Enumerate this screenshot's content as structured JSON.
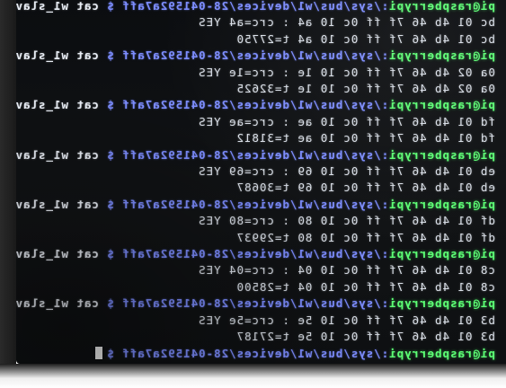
{
  "terminal": {
    "prompt_user": "pi@raspberrypi",
    "prompt_path": ":/sys/bus/w1/devices/28-041592a7aff $",
    "command": "cat w1_slave",
    "lines": [
      {
        "kind": "cmd",
        "user": "pi@raspberrypi",
        "path": ":/sys/bus/w1/devices/28-041592a7aff $",
        "cmd": "cat w1_slave"
      },
      {
        "kind": "out",
        "text": "bc 01 4b 46 7f ff 0c 10 a4 : crc=a4 YES"
      },
      {
        "kind": "out",
        "text": "bc 01 4b 46 7f ff 0c 10 a4 t=27750"
      },
      {
        "kind": "cmd",
        "user": "pi@raspberrypi",
        "path": ":/sys/bus/w1/devices/28-041592a7aff $",
        "cmd": "cat w1_slave"
      },
      {
        "kind": "out",
        "text": "0a 02 4b 46 7f ff 0c 10 1e : crc=1e YES"
      },
      {
        "kind": "out",
        "text": "0a 02 4b 46 7f ff 0c 10 1e t=32625"
      },
      {
        "kind": "cmd",
        "user": "pi@raspberrypi",
        "path": ":/sys/bus/w1/devices/28-041592a7aff $",
        "cmd": "cat w1_slave"
      },
      {
        "kind": "out",
        "text": "fd 01 4b 46 7f ff 0c 10 ae : crc=ae YES"
      },
      {
        "kind": "out",
        "text": "fd 01 4b 46 7f ff 0c 10 ae t=31812"
      },
      {
        "kind": "cmd",
        "user": "pi@raspberrypi",
        "path": ":/sys/bus/w1/devices/28-041592a7aff $",
        "cmd": "cat w1_slave"
      },
      {
        "kind": "out",
        "text": "eb 01 4b 46 7f ff 0c 10 69 : crc=69 YES"
      },
      {
        "kind": "out",
        "text": "eb 01 4b 46 7f ff 0c 10 69 t=30687"
      },
      {
        "kind": "cmd",
        "user": "pi@raspberrypi",
        "path": ":/sys/bus/w1/devices/28-041592a7aff $",
        "cmd": "cat w1_slave"
      },
      {
        "kind": "out",
        "text": "df 01 4b 46 7f ff 0c 10 80 : crc=80 YES"
      },
      {
        "kind": "out",
        "text": "df 01 4b 46 7f ff 0c 10 80 t=29937"
      },
      {
        "kind": "cmd",
        "user": "pi@raspberrypi",
        "path": ":/sys/bus/w1/devices/28-041592a7aff $",
        "cmd": "cat w1_slave"
      },
      {
        "kind": "out",
        "text": "c8 01 4b 46 7f ff 0c 10 04 : crc=04 YES"
      },
      {
        "kind": "out",
        "text": "c8 01 4b 46 7f ff 0c 10 04 t=28500"
      },
      {
        "kind": "cmd",
        "user": "pi@raspberrypi",
        "path": ":/sys/bus/w1/devices/28-041592a7aff $",
        "cmd": "cat w1_slave"
      },
      {
        "kind": "out",
        "text": "b3 01 4b 46 7f ff 0c 10 5e : crc=5e YES"
      },
      {
        "kind": "out",
        "text": "b3 01 4b 46 7f ff 0c 10 5e t=27187"
      },
      {
        "kind": "prompt",
        "user": "pi@raspberrypi",
        "path": ":/sys/bus/w1/devices/28-041592a7aff $",
        "cmd": ""
      }
    ]
  },
  "colors": {
    "prompt_user": "#5dff75",
    "prompt_path": "#7d8dff",
    "output_text": "#d9dfe8",
    "background": "#0b0d10"
  }
}
